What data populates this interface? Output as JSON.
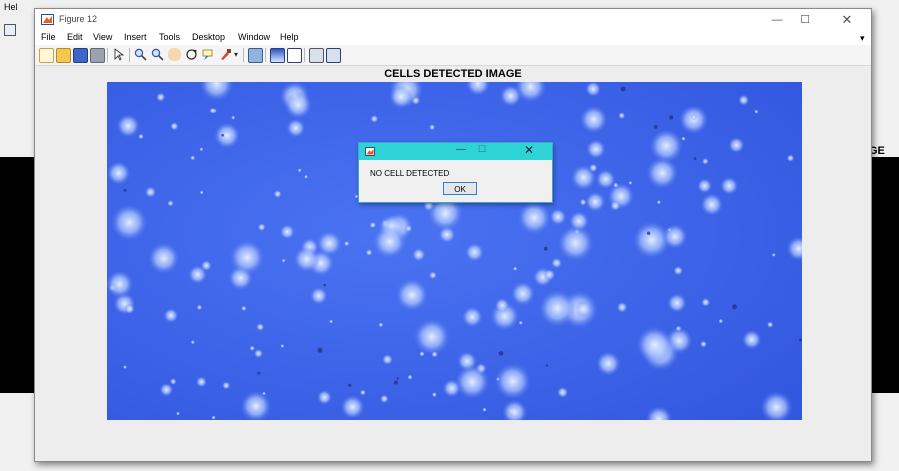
{
  "background": {
    "menu_text": "Hel",
    "right_label": "GE"
  },
  "figure": {
    "title": "Figure 12",
    "icon": "matlab-figure-icon",
    "controls": {
      "minimize": "—",
      "maximize": "☐",
      "close": "✕"
    },
    "menu": [
      "File",
      "Edit",
      "View",
      "Insert",
      "Tools",
      "Desktop",
      "Window",
      "Help"
    ],
    "menu_overflow": "▾",
    "toolbar_icons": [
      "new-figure-icon",
      "open-file-icon",
      "save-icon",
      "print-icon",
      "select-arrow-icon",
      "zoom-in-icon",
      "zoom-out-icon",
      "pan-hand-icon",
      "rotate-3d-icon",
      "data-cursor-icon",
      "brush-icon",
      "brush-dropdown-icon",
      "link-plot-icon",
      "insert-colorbar-icon",
      "insert-legend-icon",
      "hide-plot-tools-icon",
      "show-plot-tools-icon"
    ],
    "plot_title": "CELLS DETECTED IMAGE"
  },
  "dialog": {
    "icon": "matlab-figure-icon",
    "controls": {
      "minimize": "—",
      "maximize": "☐",
      "close": "✕"
    },
    "message": "NO CELL DETECTED",
    "ok_label": "OK"
  },
  "colors": {
    "image_base": "#3f66ea",
    "dialog_titlebar": "#2ed3d6",
    "ok_border": "#2c7fd6"
  }
}
